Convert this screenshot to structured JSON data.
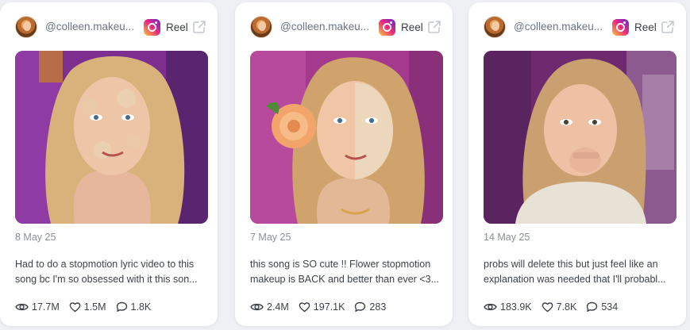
{
  "posts": [
    {
      "handle": "@colleen.makeu...",
      "platform_label": "Reel",
      "date": "8 May 25",
      "caption": "Had to do a stopmotion lyric video to this song bc I'm so obsessed with it this son...",
      "views": "17.7M",
      "likes": "1.5M",
      "comments": "1.8K"
    },
    {
      "handle": "@colleen.makeu...",
      "platform_label": "Reel",
      "date": "7 May 25",
      "caption": "this song is SO cute !! Flower stopmotion makeup is BACK and better than ever <3...",
      "views": "2.4M",
      "likes": "197.1K",
      "comments": "283"
    },
    {
      "handle": "@colleen.makeu...",
      "platform_label": "Reel",
      "date": "14 May 25",
      "caption": "probs will delete this but just feel like an explanation was needed that I'll probabl...",
      "views": "183.9K",
      "likes": "7.8K",
      "comments": "534"
    }
  ],
  "icons": {
    "platform": "instagram-icon",
    "open": "external-link-icon",
    "views": "eye-icon",
    "likes": "heart-icon",
    "comments": "comment-icon"
  },
  "colors": {
    "background": "#eef0f4",
    "card": "#ffffff",
    "muted_text": "#8a8f98"
  }
}
